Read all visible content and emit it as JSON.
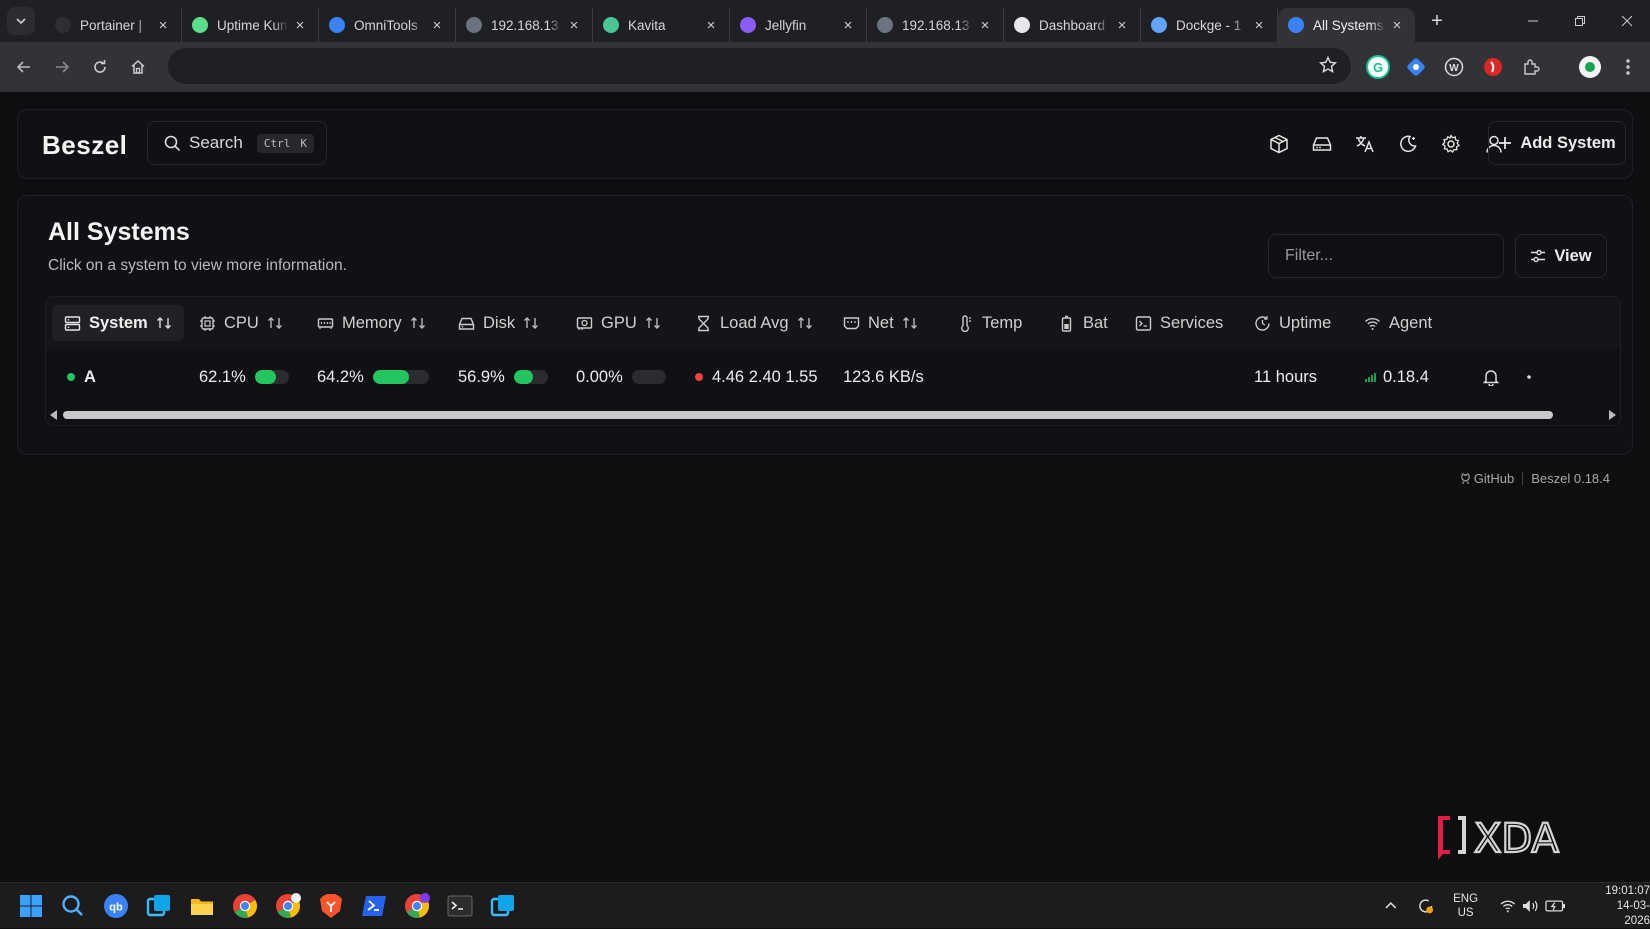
{
  "browser": {
    "tabs": [
      {
        "label": "Portainer |",
        "favicon": "portainer-icon",
        "color": "#2f2f33"
      },
      {
        "label": "Uptime Kuma",
        "favicon": "uptime-kuma-icon",
        "color": "#5cdd8b"
      },
      {
        "label": "OmniTools",
        "favicon": "omnitools-icon",
        "color": "#3b82f6"
      },
      {
        "label": "192.168.13",
        "favicon": "globe-icon",
        "color": "#6b7280"
      },
      {
        "label": "Kavita",
        "favicon": "kavita-icon",
        "color": "#4ac694"
      },
      {
        "label": "Jellyfin",
        "favicon": "jellyfin-icon",
        "color": "#8b5cf6"
      },
      {
        "label": "192.168.13",
        "favicon": "globe-icon",
        "color": "#6b7280"
      },
      {
        "label": "Dashboard",
        "favicon": "dashboard-icon",
        "color": "#e5e7eb"
      },
      {
        "label": "Dockge - 1",
        "favicon": "dockge-icon",
        "color": "#60a5fa"
      },
      {
        "label": "All Systems",
        "favicon": "beszel-icon",
        "color": "#3b82f6",
        "active": true
      }
    ],
    "new_tab": "+",
    "address": ""
  },
  "app": {
    "logo": "Beszel",
    "search": {
      "label": "Search",
      "kbd": [
        "Ctrl",
        "K"
      ]
    },
    "add_system": "Add System"
  },
  "page": {
    "title": "All Systems",
    "subtitle": "Click on a system to view more information.",
    "filter_placeholder": "Filter...",
    "view_label": "View"
  },
  "table": {
    "columns": [
      "System",
      "CPU",
      "Memory",
      "Disk",
      "GPU",
      "Load Avg",
      "Net",
      "Temp",
      "Bat",
      "Services",
      "Uptime",
      "Agent"
    ],
    "rows": [
      {
        "name": "A",
        "status_color": "#22c55e",
        "cpu": "62.1%",
        "cpu_fraction": 0.621,
        "memory": "64.2%",
        "memory_fraction": 0.642,
        "disk": "56.9%",
        "disk_fraction": 0.569,
        "gpu": "0.00%",
        "gpu_fraction": 0,
        "load_avg": "4.46 2.40 1.55",
        "load_color": "#ef4444",
        "net": "123.6 KB/s",
        "uptime": "11 hours",
        "agent": "0.18.4",
        "agent_color": "#22c55e"
      }
    ]
  },
  "footer": {
    "github": "GitHub",
    "version": "Beszel 0.18.4"
  },
  "watermark": "XDA",
  "taskbar": {
    "lang_top": "ENG",
    "lang_bottom": "US",
    "time": "19:01:07",
    "date": "14-03-2026"
  },
  "colors": {
    "accent_green": "#22c55e",
    "alert_red": "#ef4444"
  }
}
